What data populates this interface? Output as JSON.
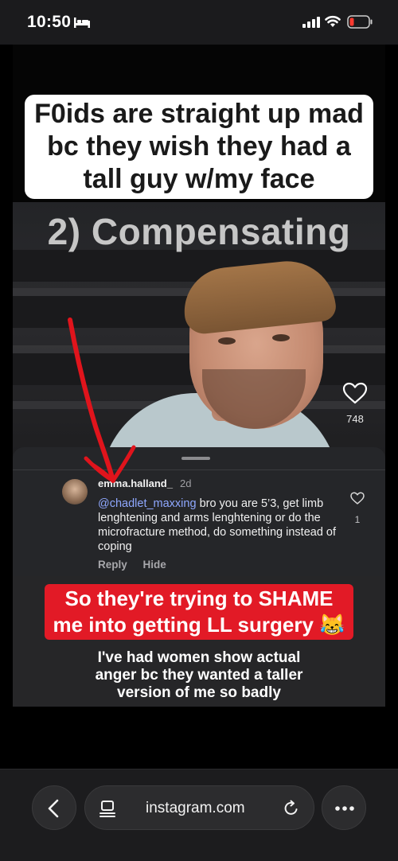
{
  "status_bar": {
    "time": "10:50"
  },
  "video": {
    "caption": "F0ids are straight up mad bc they wish they had a tall guy w/my face",
    "caption_lines": [
      "F0ids are straight up mad",
      "bc they wish they had a",
      "tall guy w/my face"
    ],
    "overlay_title": "2) Compensating",
    "like_count": "748",
    "shame_caption_lines": [
      "So they're trying to SHAME",
      "me into getting LL surgery 😹"
    ],
    "sub_caption_lines": [
      "I've had women show actual",
      "anger bc they wanted a taller",
      "version of me so badly"
    ]
  },
  "comment": {
    "username": "emma.halland_",
    "time": "2d",
    "mention": "@chadlet_maxxing",
    "text": " bro you are 5’3, get limb lenghtening and arms lenghtening or do the microfracture method, do something instead of coping",
    "like_count": "1",
    "reply_label": "Reply",
    "hide_label": "Hide"
  },
  "toolbar": {
    "url": "instagram.com"
  },
  "colors": {
    "accent_red": "#e21a26",
    "mention_blue": "#8fa8ff"
  }
}
